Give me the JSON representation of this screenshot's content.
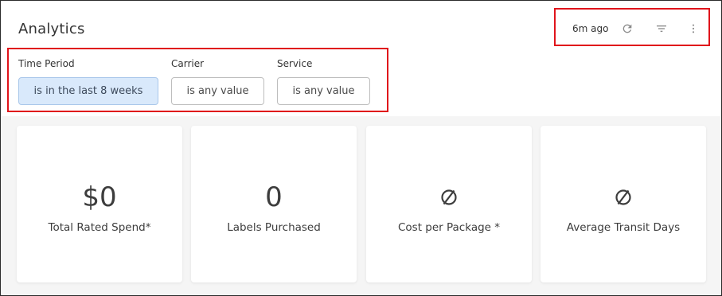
{
  "header": {
    "title": "Analytics",
    "updated_ago": "6m ago",
    "icons": [
      "refresh-icon",
      "filter-icon",
      "more-vertical-icon"
    ]
  },
  "filters": [
    {
      "label": "Time Period",
      "value": "is in the last 8 weeks",
      "active": true
    },
    {
      "label": "Carrier",
      "value": "is any value",
      "active": false
    },
    {
      "label": "Service",
      "value": "is any value",
      "active": false
    }
  ],
  "cards": [
    {
      "value": "$0",
      "label": "Total Rated Spend*"
    },
    {
      "value": "0",
      "label": "Labels Purchased"
    },
    {
      "value": null,
      "empty_icon": "empty-set-icon",
      "label": "Cost per Package *"
    },
    {
      "value": null,
      "empty_icon": "empty-set-icon",
      "label": "Average Transit Days"
    }
  ],
  "colors": {
    "highlight_border": "#e0141b",
    "active_filter_bg": "#d9e9fb",
    "page_bg": "#f5f5f5"
  }
}
